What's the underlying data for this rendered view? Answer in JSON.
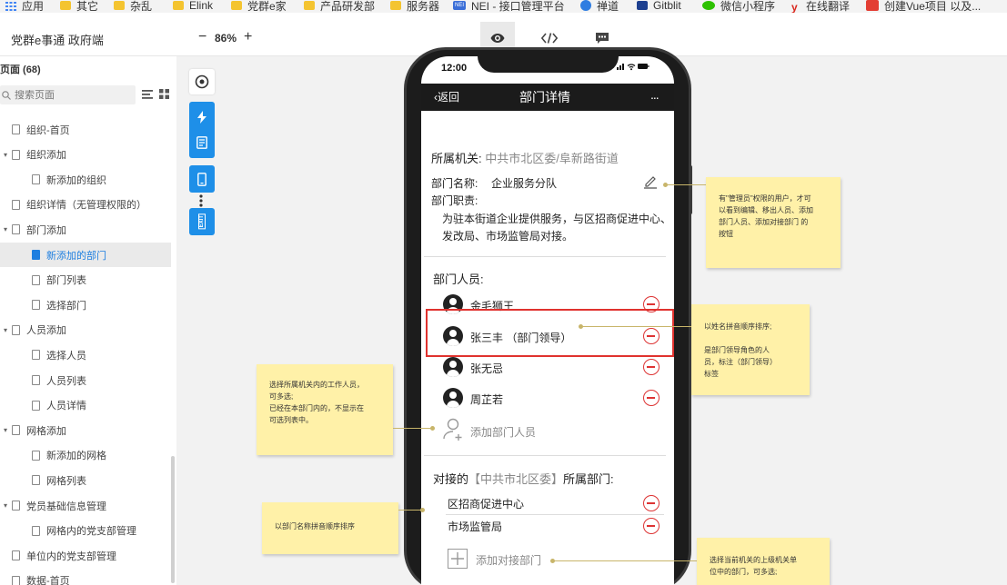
{
  "bookmarks": [
    {
      "label": "应用",
      "icon": "apps-grid-icon"
    },
    {
      "label": "其它",
      "icon": "folder-icon"
    },
    {
      "label": "杂乱",
      "icon": "folder-icon"
    },
    {
      "label": "Elink",
      "icon": "folder-icon"
    },
    {
      "label": "党群e家",
      "icon": "folder-icon"
    },
    {
      "label": "产品研发部",
      "icon": "folder-icon"
    },
    {
      "label": "服务器",
      "icon": "folder-icon"
    },
    {
      "label": "NEI - 接口管理平台",
      "icon": "nei-icon",
      "icon_text": "NEI"
    },
    {
      "label": "禅道",
      "icon": "zentao-icon"
    },
    {
      "label": "Gitblit",
      "icon": "gitblit-icon"
    },
    {
      "label": "微信小程序",
      "icon": "wechat-icon"
    },
    {
      "label": "在线翻译",
      "icon": "translate-icon"
    },
    {
      "label": "创建Vue项目 以及...",
      "icon": "csdn-icon"
    }
  ],
  "toolbar": {
    "project_title": "党群e事通 政府端",
    "zoom_minus": "−",
    "zoom_level": "86%",
    "zoom_plus": "+"
  },
  "sidebar": {
    "header": "页面 (68)",
    "search_placeholder": "搜索页面",
    "items": [
      {
        "label": "组织-首页",
        "level": 0,
        "caret": false
      },
      {
        "label": "组织添加",
        "level": 0,
        "caret": true
      },
      {
        "label": "新添加的组织",
        "level": 1,
        "caret": false
      },
      {
        "label": "组织详情（无管理权限的）",
        "level": 0,
        "caret": false
      },
      {
        "label": "部门添加",
        "level": 0,
        "caret": true
      },
      {
        "label": "新添加的部门",
        "level": 1,
        "caret": false,
        "active": true
      },
      {
        "label": "部门列表",
        "level": 1,
        "caret": false
      },
      {
        "label": "选择部门",
        "level": 1,
        "caret": false
      },
      {
        "label": "人员添加",
        "level": 0,
        "caret": true
      },
      {
        "label": "选择人员",
        "level": 1,
        "caret": false
      },
      {
        "label": "人员列表",
        "level": 1,
        "caret": false
      },
      {
        "label": "人员详情",
        "level": 1,
        "caret": false
      },
      {
        "label": "网格添加",
        "level": 0,
        "caret": true
      },
      {
        "label": "新添加的网格",
        "level": 1,
        "caret": false
      },
      {
        "label": "网格列表",
        "level": 1,
        "caret": false
      },
      {
        "label": "党员基础信息管理",
        "level": 0,
        "caret": true
      },
      {
        "label": "网格内的党支部管理",
        "level": 1,
        "caret": false
      },
      {
        "label": "单位内的党支部管理",
        "level": 0,
        "caret": false
      },
      {
        "label": "数据-首页",
        "level": 0,
        "caret": false
      }
    ]
  },
  "rail": {
    "exit_label": "EXIT"
  },
  "phone": {
    "status_time": "12:00",
    "status_icons": "..ıl ᯤ ▬",
    "back_label": "返回",
    "title": "部门详情",
    "more": "...",
    "org_label": "所属机关:",
    "org_value": "中共市北区委/阜新路街道",
    "dept_name_label": "部门名称:",
    "dept_name_value": "企业服务分队",
    "dept_duty_label": "部门职责:",
    "dept_duty_line1": "为驻本街道企业提供服务，与区招商促进中心、",
    "dept_duty_line2": "发改局、市场监管局对接。",
    "members_label": "部门人员:",
    "members": [
      {
        "name": "金毛狮王"
      },
      {
        "name": "张三丰  （部门领导）"
      },
      {
        "name": "张无忌"
      },
      {
        "name": "周芷若"
      }
    ],
    "add_member_label": "添加部门人员",
    "linked_prefix": "对接的",
    "linked_org": "【中共市北区委】",
    "linked_suffix": "所属部门:",
    "linked_depts": [
      {
        "name": "区招商促进中心"
      },
      {
        "name": "市场监管局"
      }
    ],
    "add_linked_label": "添加对接部门"
  },
  "notes": {
    "note1": "有\"管理员\"权限的用户，才可\n以看到编辑、移出人员、添加\n部门人员、添加对接部门 的\n按钮",
    "note2": "以姓名拼音顺序排序;\n\n是部门领导角色的人\n员，标注（部门领导）\n标签",
    "note3": "选择所属机关内的工作人员，\n可多选;\n已经在本部门内的，不显示在\n可选列表中。",
    "note4": "以部门名称拼音顺序排序",
    "note5": "选择当前机关的上级机关单\n位中的部门，可多选;"
  },
  "colors": {
    "accent": "#1e8fe8",
    "danger": "#d33333",
    "highlight": "#e0322e",
    "note": "#fff1a8"
  }
}
